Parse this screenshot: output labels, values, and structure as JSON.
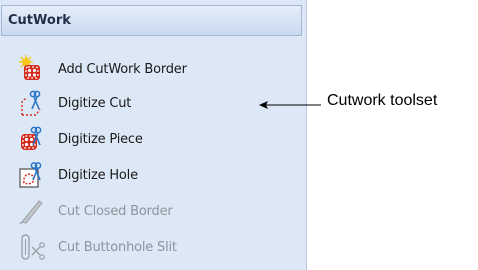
{
  "panel": {
    "title": "CutWork",
    "tools": [
      {
        "label": "Add CutWork Border",
        "icon": "add-cutwork-border-icon",
        "enabled": true
      },
      {
        "label": "Digitize Cut",
        "icon": "digitize-cut-icon",
        "enabled": true
      },
      {
        "label": "Digitize Piece",
        "icon": "digitize-piece-icon",
        "enabled": true
      },
      {
        "label": "Digitize Hole",
        "icon": "digitize-hole-icon",
        "enabled": true
      },
      {
        "label": "Cut Closed Border",
        "icon": "cut-closed-border-icon",
        "enabled": false
      },
      {
        "label": "Cut Buttonhole Slit",
        "icon": "cut-buttonhole-slit-icon",
        "enabled": false
      }
    ]
  },
  "annotation": {
    "label": "Cutwork toolset"
  },
  "colors": {
    "panel_bg": "#dde8f6",
    "header_border": "#9fb6d6",
    "icon_red": "#d42a1c",
    "icon_blue": "#2a74c8",
    "disabled_text": "#8e939b"
  }
}
